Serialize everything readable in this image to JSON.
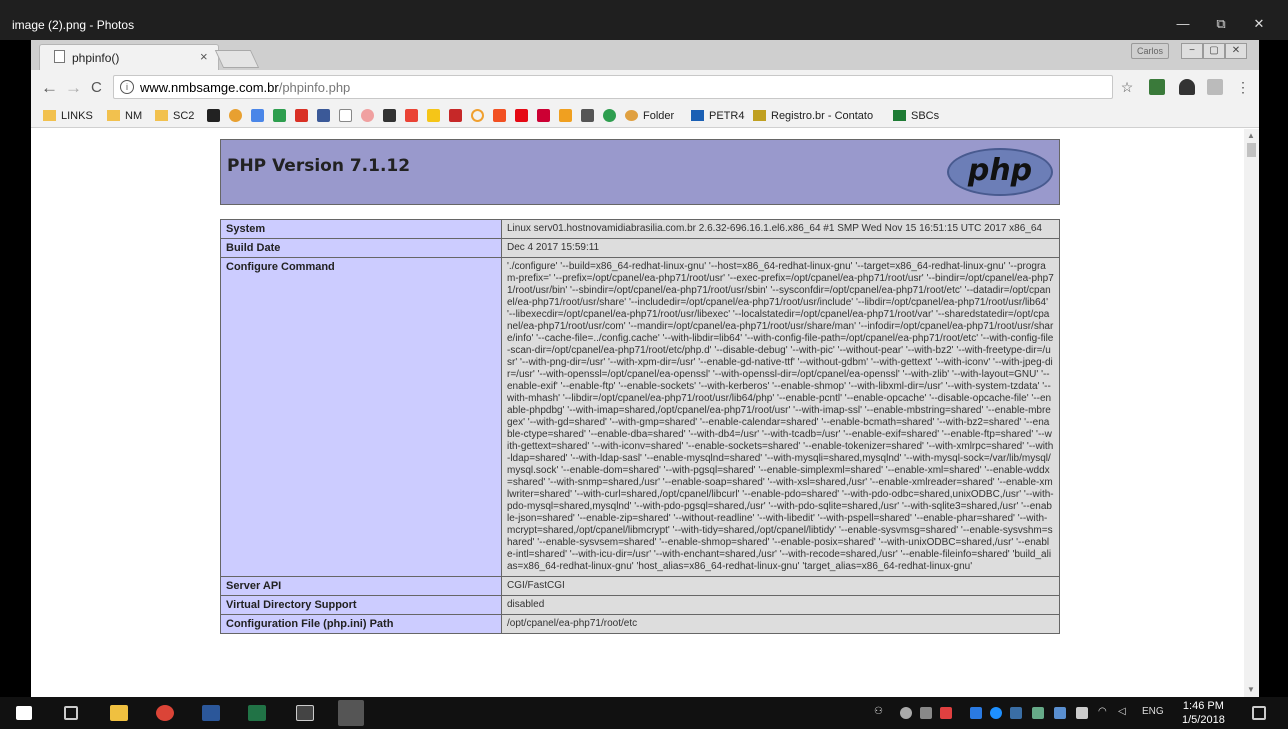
{
  "photos": {
    "title": "image (2).png - Photos",
    "min": "—",
    "restore": "⧉",
    "close": "✕"
  },
  "chrome": {
    "tab_title": "phpinfo()",
    "tab_close": "×",
    "profile": "Carlos",
    "btn_min": "−",
    "btn_restore": "▢",
    "btn_close": "✕",
    "back": "←",
    "forward": "→",
    "reload": "C",
    "url_host": "www.nmbsamge.com.br",
    "url_path": "/phpinfo.php",
    "star": "☆",
    "menu": "⋮"
  },
  "bookmarks": [
    {
      "label": "LINKS"
    },
    {
      "label": "NM"
    },
    {
      "label": "SC2"
    },
    {
      "label": "Folder"
    },
    {
      "label": "PETR4"
    },
    {
      "label": "Registro.br - Contato"
    },
    {
      "label": "SBCs"
    }
  ],
  "php": {
    "version": "PHP Version 7.1.12",
    "logo": "php"
  },
  "rows": [
    {
      "label": "System",
      "value": "Linux serv01.hostnovamidiabrasilia.com.br 2.6.32-696.16.1.el6.x86_64 #1 SMP Wed Nov 15 16:51:15 UTC 2017 x86_64"
    },
    {
      "label": "Build Date",
      "value": "Dec 4 2017 15:59:11"
    },
    {
      "label": "Configure Command",
      "value": "'./configure' '--build=x86_64-redhat-linux-gnu' '--host=x86_64-redhat-linux-gnu' '--target=x86_64-redhat-linux-gnu' '--program-prefix=' '--prefix=/opt/cpanel/ea-php71/root/usr' '--exec-prefix=/opt/cpanel/ea-php71/root/usr' '--bindir=/opt/cpanel/ea-php71/root/usr/bin' '--sbindir=/opt/cpanel/ea-php71/root/usr/sbin' '--sysconfdir=/opt/cpanel/ea-php71/root/etc' '--datadir=/opt/cpanel/ea-php71/root/usr/share' '--includedir=/opt/cpanel/ea-php71/root/usr/include' '--libdir=/opt/cpanel/ea-php71/root/usr/lib64' '--libexecdir=/opt/cpanel/ea-php71/root/usr/libexec' '--localstatedir=/opt/cpanel/ea-php71/root/var' '--sharedstatedir=/opt/cpanel/ea-php71/root/usr/com' '--mandir=/opt/cpanel/ea-php71/root/usr/share/man' '--infodir=/opt/cpanel/ea-php71/root/usr/share/info' '--cache-file=../config.cache' '--with-libdir=lib64' '--with-config-file-path=/opt/cpanel/ea-php71/root/etc' '--with-config-file-scan-dir=/opt/cpanel/ea-php71/root/etc/php.d' '--disable-debug' '--with-pic' '--without-pear' '--with-bz2' '--with-freetype-dir=/usr' '--with-png-dir=/usr' '--with-xpm-dir=/usr' '--enable-gd-native-ttf' '--without-gdbm' '--with-gettext' '--with-iconv' '--with-jpeg-dir=/usr' '--with-openssl=/opt/cpanel/ea-openssl' '--with-openssl-dir=/opt/cpanel/ea-openssl' '--with-zlib' '--with-layout=GNU' '--enable-exif' '--enable-ftp' '--enable-sockets' '--with-kerberos' '--enable-shmop' '--with-libxml-dir=/usr' '--with-system-tzdata' '--with-mhash' '--libdir=/opt/cpanel/ea-php71/root/usr/lib64/php' '--enable-pcntl' '--enable-opcache' '--disable-opcache-file' '--enable-phpdbg' '--with-imap=shared,/opt/cpanel/ea-php71/root/usr' '--with-imap-ssl' '--enable-mbstring=shared' '--enable-mbregex' '--with-gd=shared' '--with-gmp=shared' '--enable-calendar=shared' '--enable-bcmath=shared' '--with-bz2=shared' '--enable-ctype=shared' '--enable-dba=shared' '--with-db4=/usr' '--with-tcadb=/usr' '--enable-exif=shared' '--enable-ftp=shared' '--with-gettext=shared' '--with-iconv=shared' '--enable-sockets=shared' '--enable-tokenizer=shared' '--with-xmlrpc=shared' '--with-ldap=shared' '--with-ldap-sasl' '--enable-mysqlnd=shared' '--with-mysqli=shared,mysqlnd' '--with-mysql-sock=/var/lib/mysql/mysql.sock' '--enable-dom=shared' '--with-pgsql=shared' '--enable-simplexml=shared' '--enable-xml=shared' '--enable-wddx=shared' '--with-snmp=shared,/usr' '--enable-soap=shared' '--with-xsl=shared,/usr' '--enable-xmlreader=shared' '--enable-xmlwriter=shared' '--with-curl=shared,/opt/cpanel/libcurl' '--enable-pdo=shared' '--with-pdo-odbc=shared,unixODBC,/usr' '--with-pdo-mysql=shared,mysqlnd' '--with-pdo-pgsql=shared,/usr' '--with-pdo-sqlite=shared,/usr' '--with-sqlite3=shared,/usr' '--enable-json=shared' '--enable-zip=shared' '--without-readline' '--with-libedit' '--with-pspell=shared' '--enable-phar=shared' '--with-mcrypt=shared,/opt/cpanel/libmcrypt' '--with-tidy=shared,/opt/cpanel/libtidy' '--enable-sysvmsg=shared' '--enable-sysvshm=shared' '--enable-sysvsem=shared' '--enable-shmop=shared' '--enable-posix=shared' '--with-unixODBC=shared,/usr' '--enable-intl=shared' '--with-icu-dir=/usr' '--with-enchant=shared,/usr' '--with-recode=shared,/usr' '--enable-fileinfo=shared' 'build_alias=x86_64-redhat-linux-gnu' 'host_alias=x86_64-redhat-linux-gnu' 'target_alias=x86_64-redhat-linux-gnu'"
    },
    {
      "label": "Server API",
      "value": "CGI/FastCGI"
    },
    {
      "label": "Virtual Directory Support",
      "value": "disabled"
    },
    {
      "label": "Configuration File (php.ini) Path",
      "value": "/opt/cpanel/ea-php71/root/etc"
    }
  ],
  "taskbar": {
    "lang": "ENG",
    "time": "1:46 PM",
    "date": "1/5/2018"
  }
}
